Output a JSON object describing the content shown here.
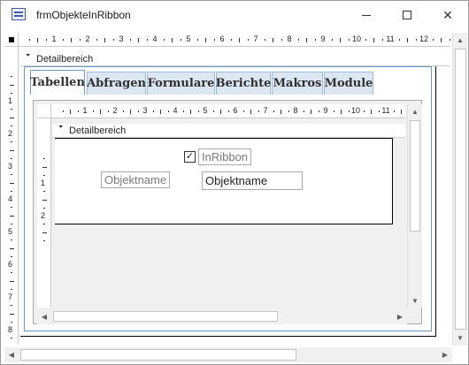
{
  "window": {
    "title": "frmObjekteInRibbon",
    "minimize_glyph": "—",
    "close_glyph": "✕"
  },
  "outer_form": {
    "section_label": "Detailbereich",
    "section_arrow": "🢓"
  },
  "tabs": [
    {
      "label": "Tabellen",
      "active": true
    },
    {
      "label": "Abfragen",
      "active": false
    },
    {
      "label": "Formulare",
      "active": false
    },
    {
      "label": "Berichte",
      "active": false
    },
    {
      "label": "Makros",
      "active": false
    },
    {
      "label": "Module",
      "active": false
    }
  ],
  "subform": {
    "section_label": "Detailbereich",
    "checkbox_checked_glyph": "✓",
    "checkbox_label": "InRibbon",
    "name_label": "Objektname",
    "name_field": "Objektname"
  },
  "rulers": {
    "outer_marks": [
      "1",
      "2",
      "3",
      "4",
      "5",
      "6",
      "7",
      "8",
      "9",
      "10",
      "11",
      "12"
    ],
    "outer_vertical_marks": [
      "1",
      "2",
      "3",
      "4",
      "5",
      "6",
      "7",
      "8"
    ],
    "inner_marks": [
      "1",
      "2",
      "3",
      "4",
      "5",
      "6",
      "7",
      "8",
      "9",
      "10",
      "11"
    ],
    "inner_vertical_marks": [
      "1",
      "2"
    ]
  },
  "scroll_arrows": {
    "up": "▲",
    "down": "▼",
    "left": "◀",
    "right": "▶"
  },
  "colors": {
    "tab_border": "#6b9ac7",
    "tab_inactive_bg": "#dde7f3",
    "detail_white": "#ffffff",
    "subform_bg": "#f0f0f0"
  }
}
